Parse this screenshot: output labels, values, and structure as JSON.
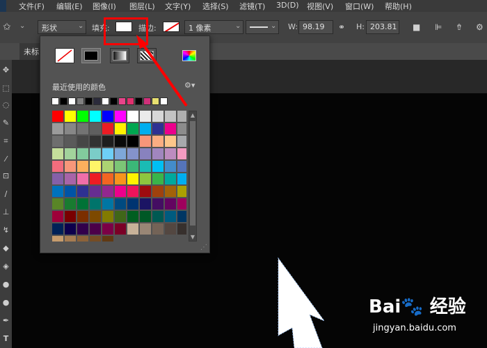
{
  "menubar": {
    "items": [
      "文件(F)",
      "编辑(E)",
      "图像(I)",
      "图层(L)",
      "文字(Y)",
      "选择(S)",
      "滤镜(T)",
      "3D(D)",
      "视图(V)",
      "窗口(W)",
      "帮助(H)"
    ]
  },
  "options": {
    "mode": "形状",
    "fill_label": "填充:",
    "stroke_label": "描边:",
    "stroke_width": "1 像素",
    "w_label": "W:",
    "w_value": "98.19",
    "h_label": "H:",
    "h_value": "203.81"
  },
  "tab": {
    "title": "未标"
  },
  "popup": {
    "recent_label": "最近使用的颜色",
    "recent_colors": [
      "#ffffff",
      "#000000",
      "#ffffff",
      "#808080",
      "#000000",
      "#2b2b3b",
      "#ffffff",
      "#000000",
      "#e8448a",
      "#e0306e",
      "#000000",
      "#d0307a",
      "#e8e070",
      "#ffffff"
    ],
    "swatches": [
      "#ff0000",
      "#ffff00",
      "#00ff00",
      "#00ffff",
      "#0000ff",
      "#ff00ff",
      "#ffffff",
      "#ebebeb",
      "#d7d7d7",
      "#c3c3c3",
      "#afafaf",
      "#9b9b9b",
      "#878787",
      "#737373",
      "#5f5f5f",
      "#eb1c24",
      "#fff200",
      "#00a650",
      "#00aeef",
      "#2e3192",
      "#ec008c",
      "#8c8c8c",
      "#6e6e6e",
      "#5a5a5a",
      "#464646",
      "#323232",
      "#1e1e1e",
      "#0a0a0a",
      "#000000",
      "#f79679",
      "#fbad82",
      "#fdc68a",
      "#a7a9ac",
      "#c4df9b",
      "#a2d39c",
      "#82ca9d",
      "#7bcdc8",
      "#6ecff6",
      "#7ea7d8",
      "#8493ca",
      "#8882be",
      "#a186be",
      "#bd8cbf",
      "#f49bc1",
      "#f26d7d",
      "#f7977a",
      "#fbaf5d",
      "#fff568",
      "#acd372",
      "#7cc576",
      "#3bb878",
      "#1abbb4",
      "#00bff3",
      "#438ccb",
      "#5574b9",
      "#8560a8",
      "#a864a8",
      "#f06ea9",
      "#ed1c24",
      "#f26522",
      "#f7941d",
      "#fff200",
      "#8dc63f",
      "#39b54a",
      "#00a99d",
      "#00aeef",
      "#0072bc",
      "#0054a6",
      "#2e3192",
      "#662d91",
      "#92278f",
      "#ec008c",
      "#ed145b",
      "#9e0b0f",
      "#a0410d",
      "#a36209",
      "#aba000",
      "#598527",
      "#197b30",
      "#007236",
      "#00746b",
      "#0076a3",
      "#004a80",
      "#003471",
      "#1b1464",
      "#440e62",
      "#630460",
      "#9e005d",
      "#9e0039",
      "#790000",
      "#7b2e00",
      "#7d4900",
      "#827b00",
      "#406618",
      "#005e20",
      "#005826",
      "#005952",
      "#005b7f",
      "#003663",
      "#002157",
      "#0d004c",
      "#32004b",
      "#4b0049",
      "#7b0046",
      "#7a0026",
      "#c7b299",
      "#998675",
      "#736357",
      "#534741",
      "#37302d",
      "#c69c6d",
      "#a67c52",
      "#8c6239",
      "#754c24",
      "#603913"
    ]
  }
}
